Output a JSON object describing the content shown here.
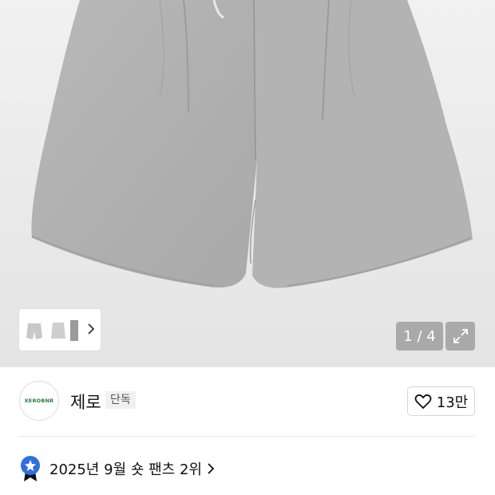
{
  "gallery": {
    "counter": "1 / 4",
    "thumbnails": [
      "shorts-front-thumb",
      "shorts-side-thumb",
      "shorts-detail-thumb"
    ]
  },
  "brand": {
    "logo_text": "XEROBNR",
    "name": "제로",
    "badge": "단독"
  },
  "like": {
    "count": "13만"
  },
  "ranking": {
    "text": "2025년 9월 숏 팬츠 2위"
  },
  "icons": {
    "expand": "expand-icon",
    "heart": "heart-icon",
    "chevron": "chevron-right-icon",
    "rank_badge": "star-ribbon-icon"
  },
  "colors": {
    "rank_badge": "#2f6fe0",
    "logo_text": "#2a7a3a"
  }
}
